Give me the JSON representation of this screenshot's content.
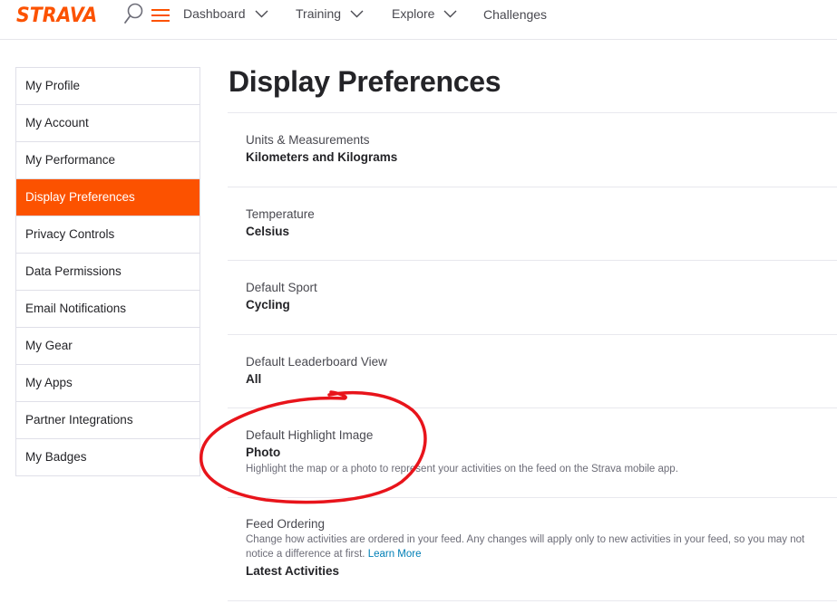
{
  "header": {
    "logo": "STRAVA",
    "nav": [
      {
        "label": "Dashboard"
      },
      {
        "label": "Training"
      },
      {
        "label": "Explore"
      },
      {
        "label": "Challenges"
      }
    ]
  },
  "sidebar": {
    "items": [
      {
        "label": "My Profile"
      },
      {
        "label": "My Account"
      },
      {
        "label": "My Performance"
      },
      {
        "label": "Display Preferences",
        "active": true
      },
      {
        "label": "Privacy Controls"
      },
      {
        "label": "Data Permissions"
      },
      {
        "label": "Email Notifications"
      },
      {
        "label": "My Gear"
      },
      {
        "label": "My Apps"
      },
      {
        "label": "Partner Integrations"
      },
      {
        "label": "My Badges"
      }
    ]
  },
  "main": {
    "title": "Display Preferences",
    "preferences": [
      {
        "label": "Units & Measurements",
        "value": "Kilometers and Kilograms"
      },
      {
        "label": "Temperature",
        "value": "Celsius"
      },
      {
        "label": "Default Sport",
        "value": "Cycling"
      },
      {
        "label": "Default Leaderboard View",
        "value": "All"
      },
      {
        "label": "Default Highlight Image",
        "value": "Photo",
        "description": "Highlight the map or a photo to represent your activities on the feed on the Strava mobile app."
      },
      {
        "label": "Feed Ordering",
        "description": "Change how activities are ordered in your feed. Any changes will apply only to new activities in your feed, so you may not notice a difference at first.",
        "link": "Learn More",
        "value": "Latest Activities"
      }
    ]
  },
  "colors": {
    "brand": "#fc5200",
    "annotation": "#e8141b",
    "link": "#007fb6"
  }
}
